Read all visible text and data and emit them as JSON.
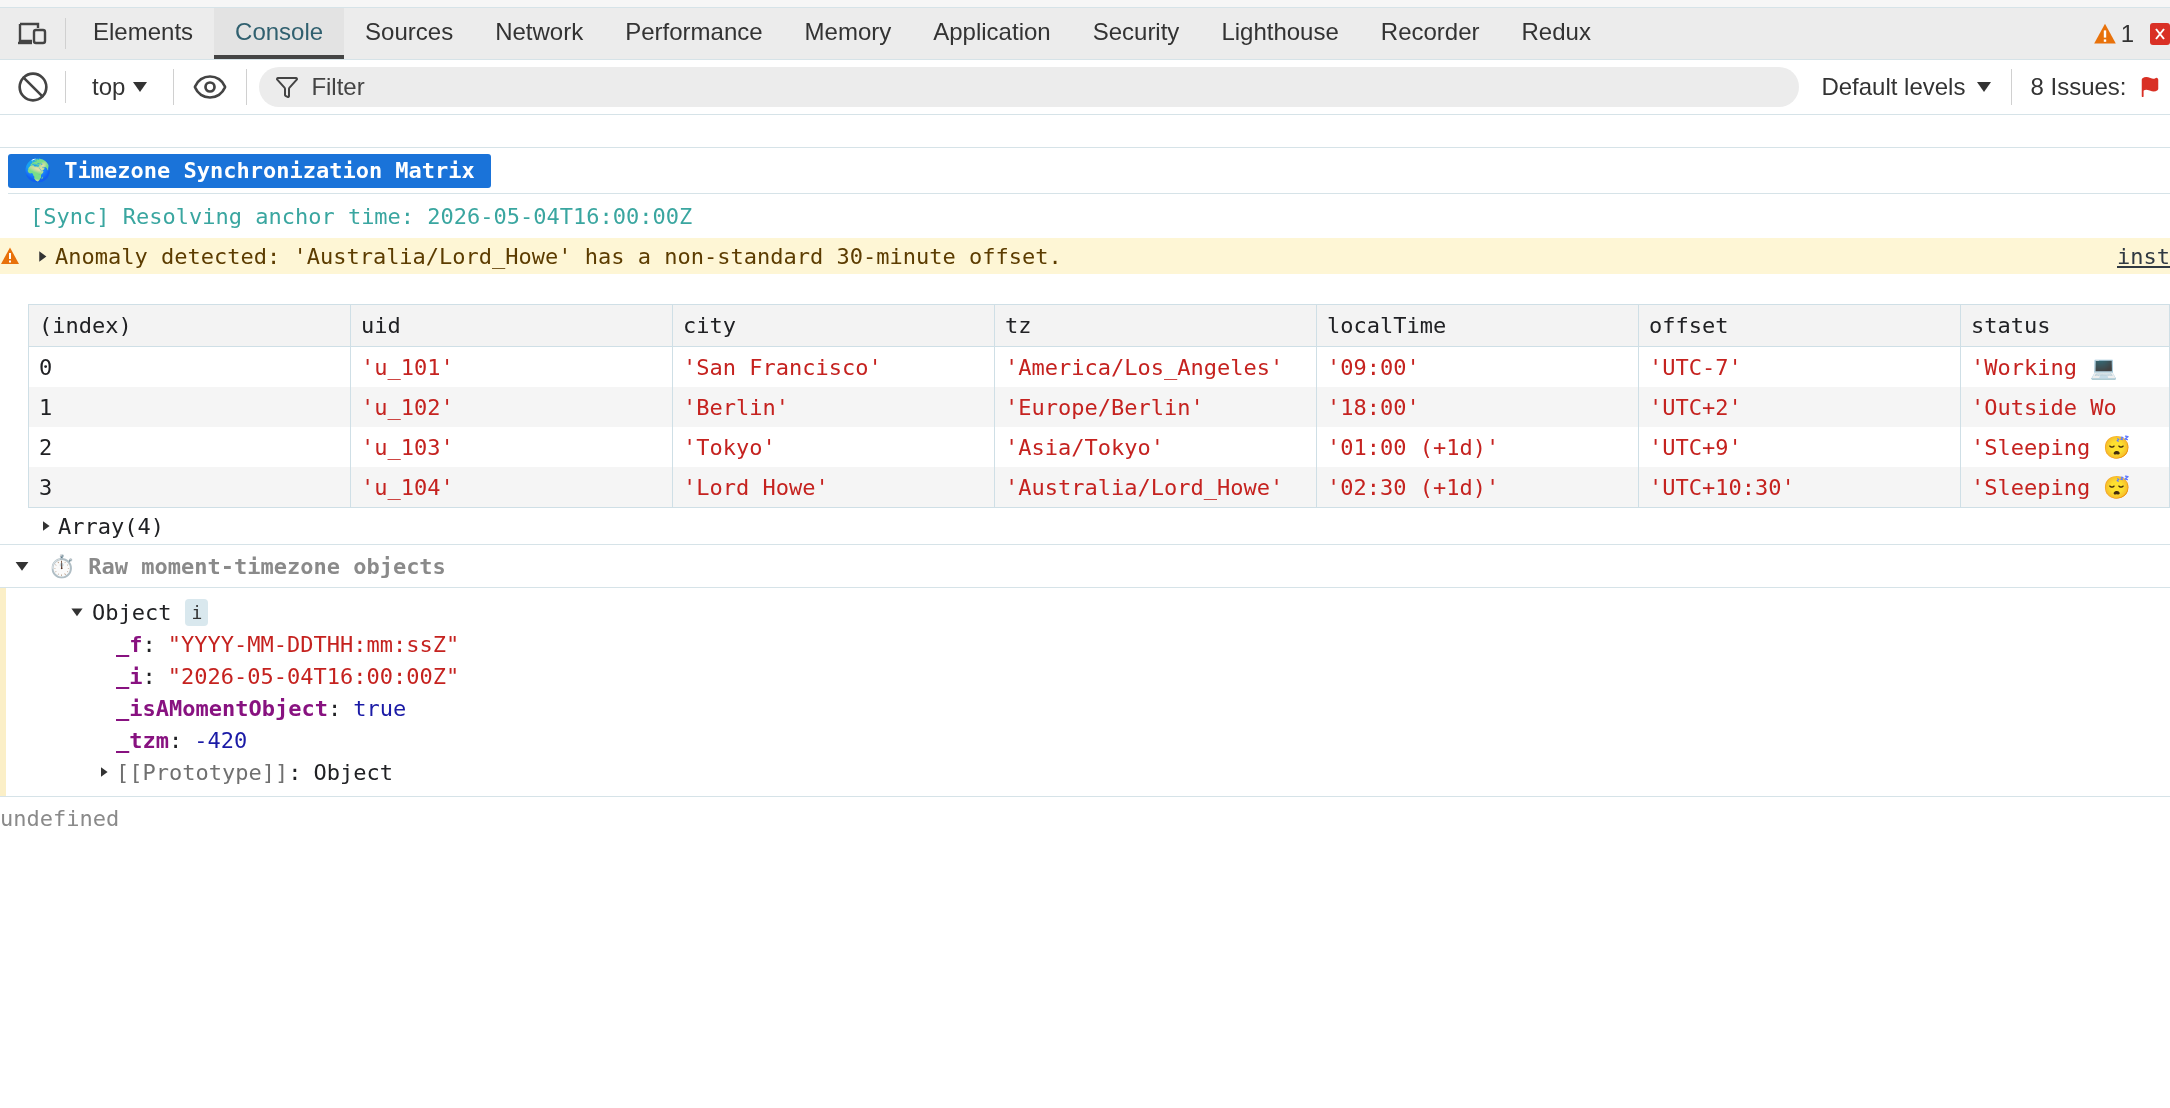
{
  "tabs": [
    {
      "label": "Elements",
      "selected": false
    },
    {
      "label": "Console",
      "selected": true
    },
    {
      "label": "Sources",
      "selected": false
    },
    {
      "label": "Network",
      "selected": false
    },
    {
      "label": "Performance",
      "selected": false
    },
    {
      "label": "Memory",
      "selected": false
    },
    {
      "label": "Application",
      "selected": false
    },
    {
      "label": "Security",
      "selected": false
    },
    {
      "label": "Lighthouse",
      "selected": false
    },
    {
      "label": "Recorder",
      "selected": false
    },
    {
      "label": "Redux",
      "selected": false
    }
  ],
  "warning_count": "1",
  "toolbar": {
    "context": "top",
    "filter_placeholder": "Filter",
    "levels": "Default levels",
    "issues": "8 Issues:"
  },
  "console": [
    {
      "kind": "badge",
      "text": "🌍 Timezone Synchronization Matrix"
    },
    {
      "kind": "log",
      "text": "[Sync] Resolving anchor time: 2026-05-04T16:00:00Z"
    },
    {
      "kind": "warning",
      "expanded": false,
      "text": "Anomaly detected: 'Australia/Lord_Howe' has a non-standard 30-minute offset.",
      "source": "inst"
    },
    {
      "kind": "table",
      "columns": [
        "(index)",
        "uid",
        "city",
        "tz",
        "localTime",
        "offset",
        "status"
      ],
      "rows": [
        [
          "0",
          "'u_101'",
          "'San Francisco'",
          "'America/Los_Angeles'",
          "'09:00'",
          "'UTC-7'",
          "'Working 💻"
        ],
        [
          "1",
          "'u_102'",
          "'Berlin'",
          "'Europe/Berlin'",
          "'18:00'",
          "'UTC+2'",
          "'Outside Wo"
        ],
        [
          "2",
          "'u_103'",
          "'Tokyo'",
          "'Asia/Tokyo'",
          "'01:00 (+1d)'",
          "'UTC+9'",
          "'Sleeping 😴"
        ],
        [
          "3",
          "'u_104'",
          "'Lord Howe'",
          "'Australia/Lord_Howe'",
          "'02:30 (+1d)'",
          "'UTC+10:30'",
          "'Sleeping 😴"
        ]
      ],
      "footer": {
        "label": "Array(4)",
        "expanded": false
      }
    },
    {
      "kind": "group",
      "expanded": true,
      "label": "⏱️ Raw moment-timezone objects",
      "object": {
        "label": "Object",
        "expanded": true,
        "info": "i",
        "separator": ":",
        "properties": [
          {
            "key": "_f",
            "value": "\"YYYY-MM-DDTHH:mm:ssZ\"",
            "kind": "string"
          },
          {
            "key": "_i",
            "value": "\"2026-05-04T16:00:00Z\"",
            "kind": "string"
          },
          {
            "key": "_isAMomentObject",
            "value": "true",
            "kind": "boolean"
          },
          {
            "key": "_tzm",
            "value": "-420",
            "kind": "number"
          }
        ],
        "prototype": {
          "key": "[[Prototype]]",
          "value": "Object",
          "expanded": false
        }
      }
    },
    {
      "kind": "result",
      "text": "undefined"
    }
  ]
}
